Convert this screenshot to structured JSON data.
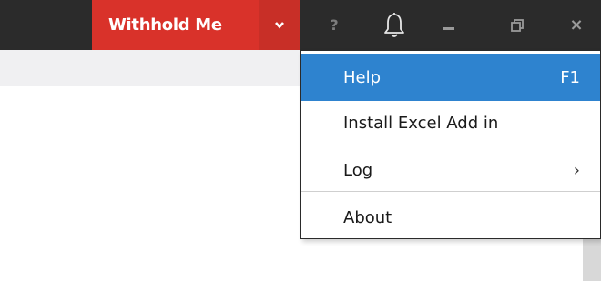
{
  "titlebar": {
    "user_button_label": "Withhold Me",
    "help_glyph": "?",
    "close_glyph": "×",
    "icons": [
      "chevron-down-icon",
      "help-icon",
      "bell-icon",
      "minimize-icon",
      "restore-icon",
      "close-icon"
    ],
    "colors": {
      "bar": "#2b2b2b",
      "user_button": "#d9322a"
    }
  },
  "menu": {
    "items": [
      {
        "label": "Help",
        "shortcut": "F1",
        "highlighted": true
      },
      {
        "label": "Install Excel Add in"
      },
      {
        "label": "Log",
        "has_submenu": true,
        "submenu_glyph": "›"
      },
      {
        "label": "About"
      }
    ],
    "colors": {
      "highlight": "#2e83cf"
    }
  }
}
